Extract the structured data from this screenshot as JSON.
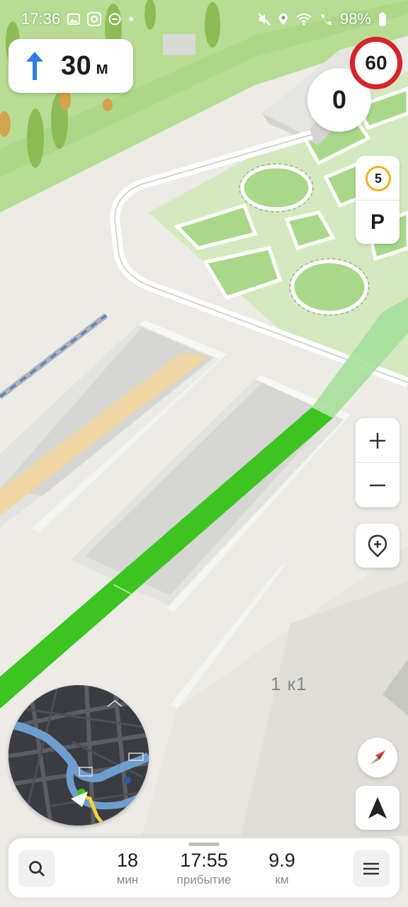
{
  "status_bar": {
    "time": "17:36",
    "battery": "98%"
  },
  "maneuver": {
    "distance": "30",
    "unit": "м"
  },
  "speed": {
    "current": "0",
    "limit": "60"
  },
  "map_controls": {
    "traffic_level": "5",
    "parking_label": "P"
  },
  "map_labels": {
    "building": "1 к1"
  },
  "trip": {
    "duration_value": "18",
    "duration_label": "мин",
    "arrival_value": "17:55",
    "arrival_label": "прибытие",
    "distance_value": "9.9",
    "distance_label": "км"
  },
  "colors": {
    "route": "#3cc421",
    "speed_limit_ring": "#d8232a",
    "traffic_ring": "#f2b01e",
    "accent_arrow": "#2f7fe0"
  }
}
